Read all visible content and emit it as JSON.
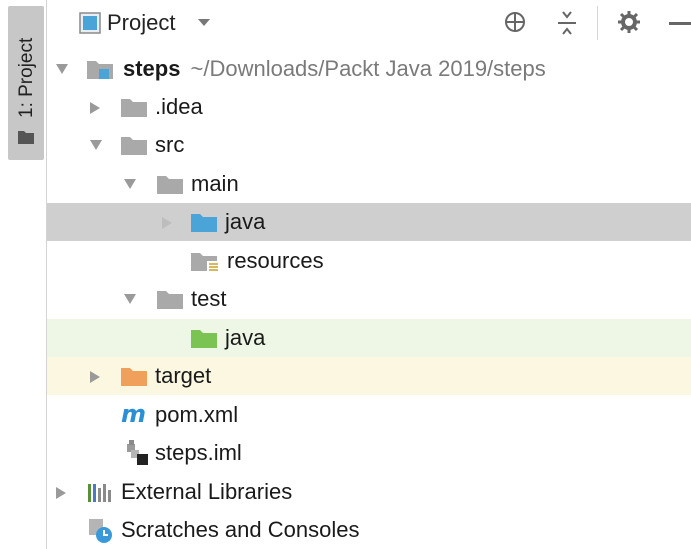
{
  "sidebar": {
    "tab_label": "1: Project"
  },
  "header": {
    "view_label": "Project"
  },
  "tree": {
    "root_name": "steps",
    "root_path": "~/Downloads/Packt Java 2019/steps",
    "idea": ".idea",
    "src": "src",
    "main": "main",
    "main_java": "java",
    "resources": "resources",
    "test": "test",
    "test_java": "java",
    "target": "target",
    "pom": "pom.xml",
    "iml": "steps.iml",
    "external_libraries": "External Libraries",
    "scratches": "Scratches and Consoles"
  },
  "colors": {
    "folder_gray": "#a9a9a9",
    "folder_blue": "#4aa4d8",
    "folder_green": "#7bc454",
    "folder_orange": "#f0a05a",
    "selected_row": "#cfcfcf",
    "green_row": "#eef7e6",
    "yellow_row": "#fbf7e0",
    "maven_m": "#2a8fd6"
  }
}
